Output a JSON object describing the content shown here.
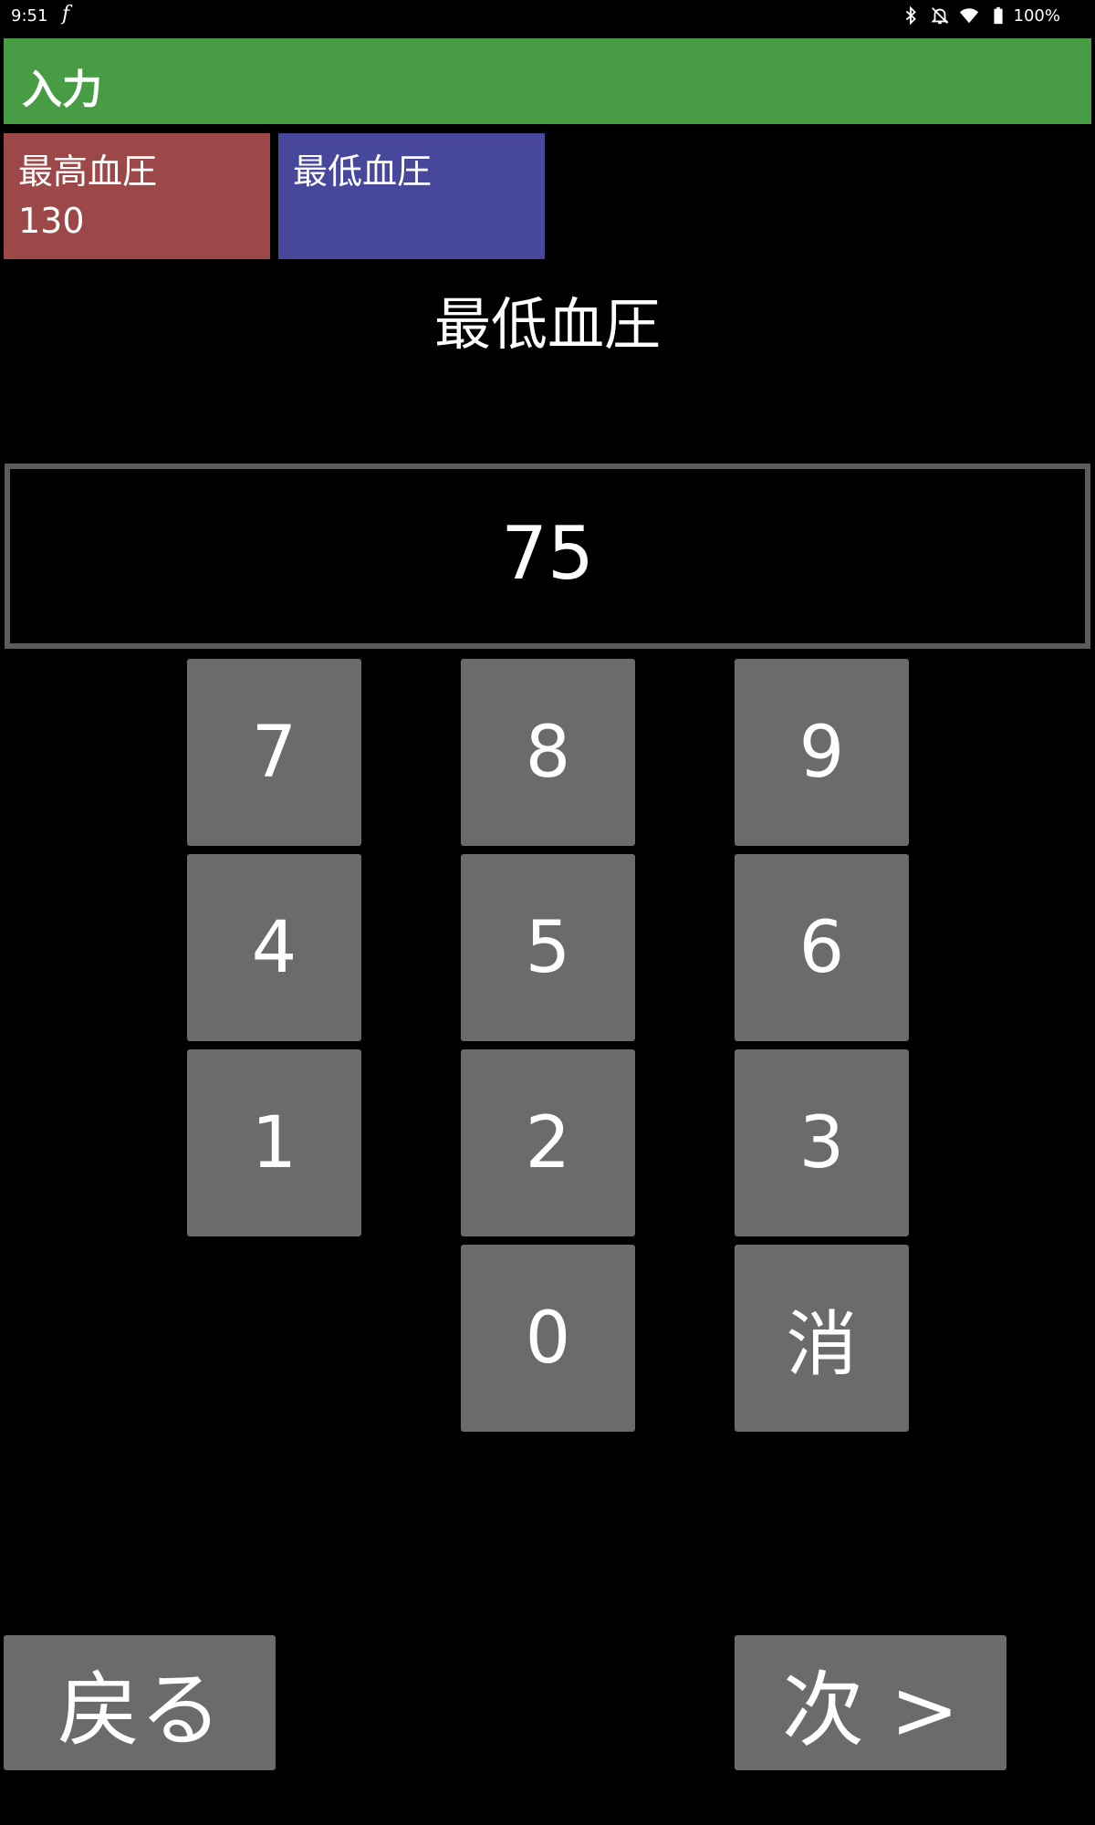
{
  "status_bar": {
    "time": "9:51",
    "app_glyph": "f",
    "icons": [
      "bluetooth-icon",
      "notifications-off-icon",
      "wifi-icon",
      "battery-icon"
    ],
    "battery": "100%"
  },
  "app_bar": {
    "title": "入力",
    "color": "#479c44"
  },
  "tabs": [
    {
      "label": "最高血圧",
      "value": "130",
      "color": "#9c4848"
    },
    {
      "label": "最低血圧",
      "value": "",
      "color": "#47489c"
    }
  ],
  "field_title": "最低血圧",
  "display_value": "75",
  "keypad": {
    "k7": "7",
    "k8": "8",
    "k9": "9",
    "k4": "4",
    "k5": "5",
    "k6": "6",
    "k1": "1",
    "k2": "2",
    "k3": "3",
    "k0": "0",
    "clear": "消"
  },
  "nav": {
    "back": "戻る",
    "next": "次 >"
  }
}
